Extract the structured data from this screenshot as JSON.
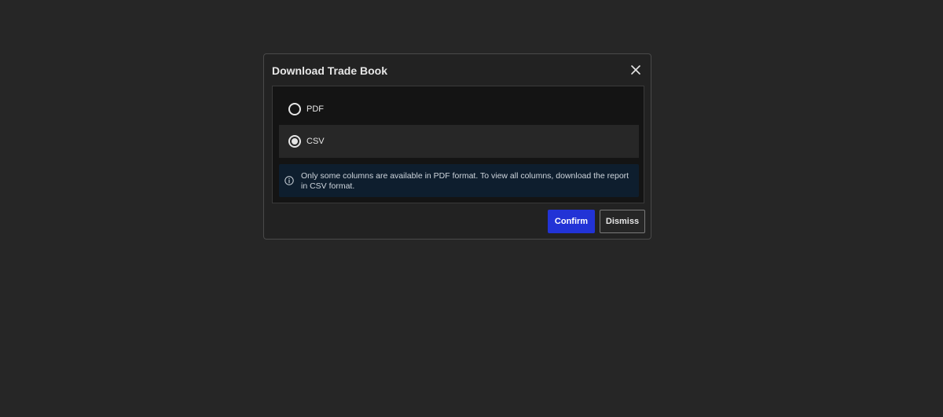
{
  "dialog": {
    "title": "Download Trade Book",
    "close_icon": "close-icon"
  },
  "options": [
    {
      "label": "PDF",
      "selected": false
    },
    {
      "label": "CSV",
      "selected": true
    }
  ],
  "notice": {
    "icon": "info-icon",
    "text": "Only some columns are available in PDF format. To view all columns, download the report in CSV format."
  },
  "actions": {
    "confirm_label": "Confirm",
    "dismiss_label": "Dismiss"
  },
  "colors": {
    "background": "#262626",
    "primary_button": "#2233d6",
    "notice_background": "#0e1e2e"
  }
}
